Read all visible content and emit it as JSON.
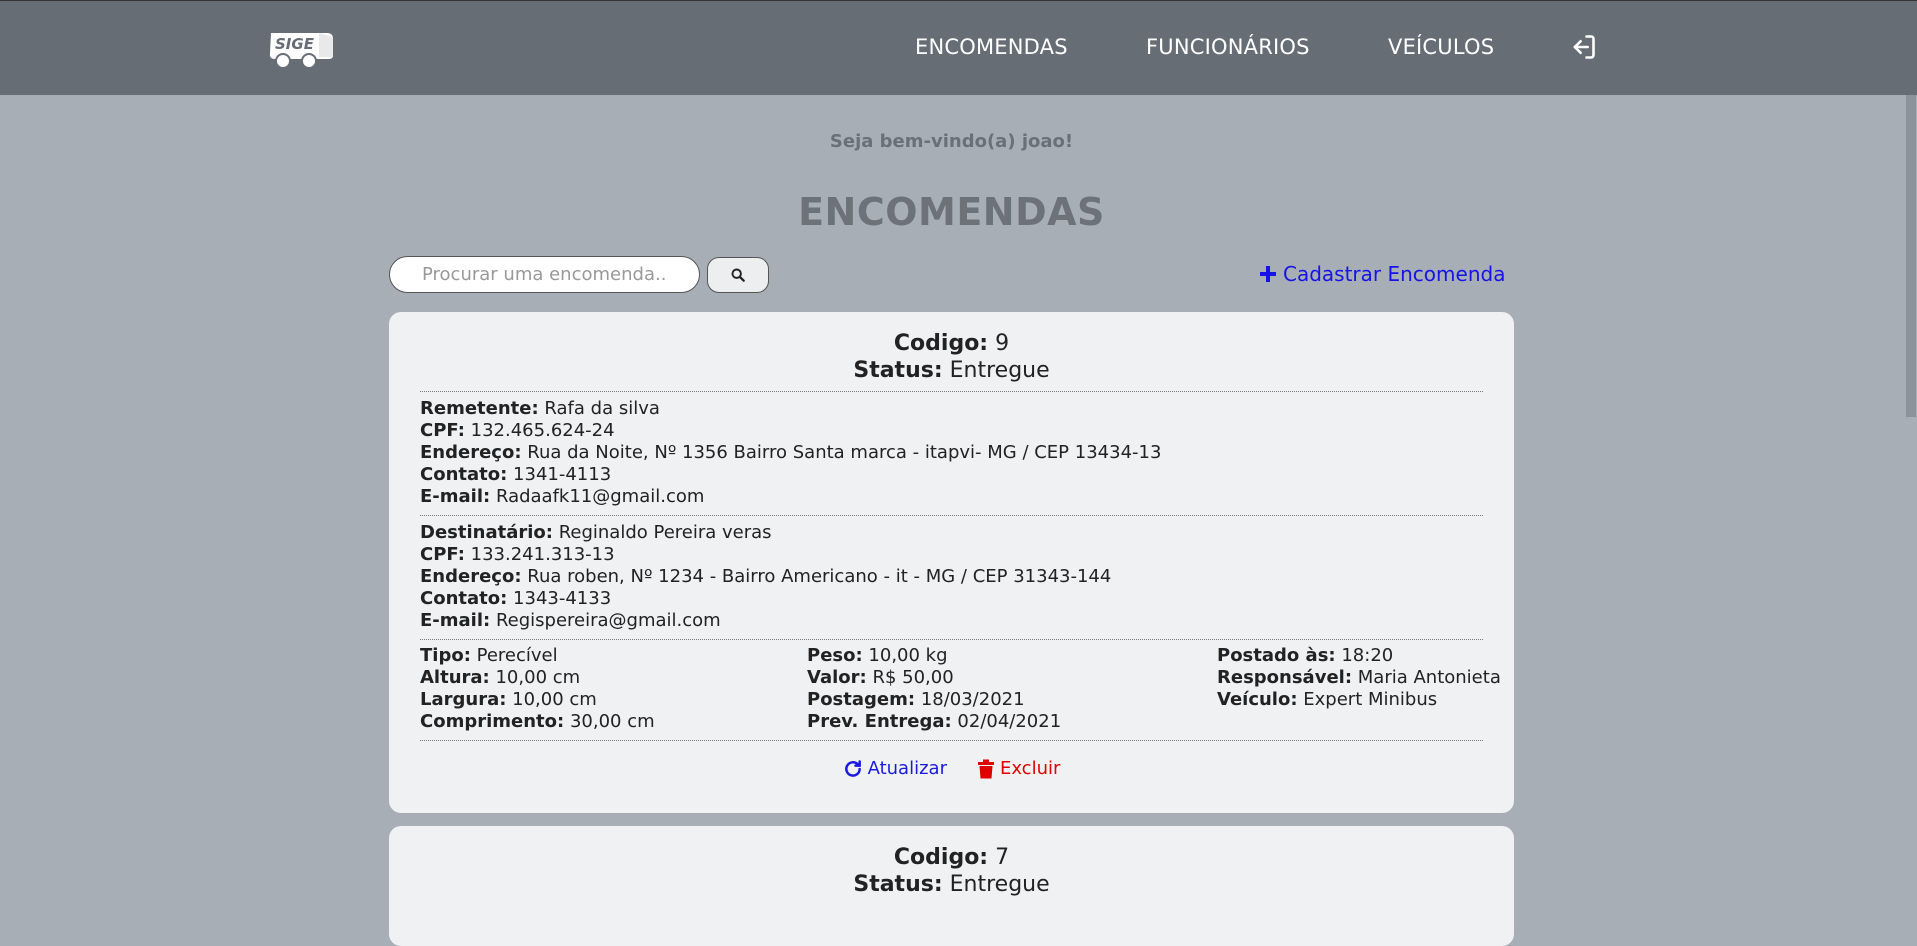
{
  "nav": {
    "logo_text": "SIGE",
    "links": [
      "ENCOMENDAS",
      "FUNCIONÁRIOS",
      "VEÍCULOS"
    ],
    "logout_icon": "sign-out-icon"
  },
  "welcome": "Seja bem-vindo(a) joao!",
  "title": "ENCOMENDAS",
  "search": {
    "placeholder": "Procurar uma encomenda...",
    "button_icon": "search-icon"
  },
  "add_label": "Cadastrar Encomenda",
  "labels": {
    "codigo": "Codigo:",
    "status": "Status:",
    "remetente": "Remetente:",
    "destinatario": "Destinatário:",
    "cpf": "CPF:",
    "endereco": "Endereço:",
    "contato": "Contato:",
    "email": "E-mail:",
    "tipo": "Tipo:",
    "altura": "Altura:",
    "largura": "Largura:",
    "comprimento": "Comprimento:",
    "peso": "Peso:",
    "valor": "Valor:",
    "postagem": "Postagem:",
    "prev_entrega": "Prev. Entrega:",
    "postado": "Postado às:",
    "responsavel": "Responsável:",
    "veiculo": "Veículo:"
  },
  "orders": [
    {
      "codigo": "9",
      "status": "Entregue",
      "remetente": {
        "nome": "Rafa da silva",
        "cpf": "132.465.624-24",
        "endereco": "Rua da Noite, Nº 1356 Bairro Santa marca - itapvi- MG / CEP 13434-13",
        "contato": "1341-4113",
        "email": "Radaafk11@gmail.com"
      },
      "destinatario": {
        "nome": "Reginaldo Pereira veras",
        "cpf": "133.241.313-13",
        "endereco": "Rua roben, Nº 1234 - Bairro Americano - it - MG / CEP 31343-144",
        "contato": "1343-4133",
        "email": "Regispereira@gmail.com"
      },
      "tipo": "Perecível",
      "altura": "10,00 cm",
      "largura": "10,00 cm",
      "comprimento": "30,00 cm",
      "peso": "10,00 kg",
      "valor": "R$ 50,00",
      "postagem": "18/03/2021",
      "prev_entrega": "02/04/2021",
      "postado": "18:20",
      "responsavel": "Maria Antonieta",
      "veiculo": "Expert Minibus",
      "update_label": "Atualizar",
      "delete_label": "Excluir"
    },
    {
      "codigo": "7",
      "status": "Entregue"
    }
  ],
  "colors": {
    "navbar": "#676d75",
    "background": "#a8aeb6",
    "card": "#f0f1f3",
    "link_blue": "#1414e6",
    "delete_red": "#e00000"
  }
}
